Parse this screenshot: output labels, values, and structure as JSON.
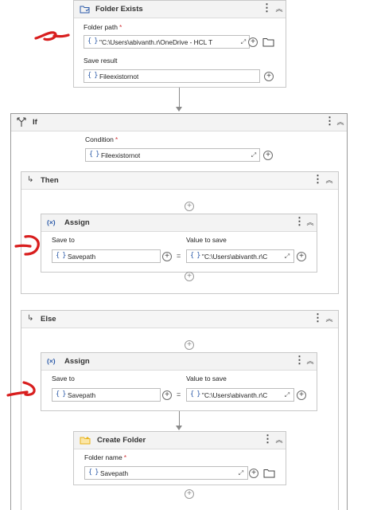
{
  "folder_exists": {
    "title": "Folder Exists",
    "folder_path_label": "Folder path",
    "folder_path_value": "\"C:\\Users\\abivanth.r\\OneDrive - HCL T",
    "save_result_label": "Save result",
    "save_result_value": "Fileexistornot"
  },
  "if_block": {
    "title": "If",
    "condition_label": "Condition",
    "condition_value": "Fileexistornot"
  },
  "then_block": {
    "title": "Then",
    "assign": {
      "title": "Assign",
      "save_to_label": "Save to",
      "save_to_value": "Savepath",
      "value_label": "Value to save",
      "value_value": "\"C:\\Users\\abivanth.r\\C"
    }
  },
  "else_block": {
    "title": "Else",
    "assign": {
      "title": "Assign",
      "save_to_label": "Save to",
      "save_to_value": "Savepath",
      "value_label": "Value to save",
      "value_value": "\"C:\\Users\\abivanth.r\\C"
    },
    "create_folder": {
      "title": "Create Folder",
      "folder_name_label": "Folder name",
      "folder_name_value": "Savepath"
    }
  },
  "symbols": {
    "required": "*",
    "braces": "{ }",
    "assign_icon": "(×)",
    "equals": "=",
    "plus": "+",
    "kebab": "⋮",
    "collapse": "︽",
    "expand": "⤢",
    "branch_arrow": "↳"
  },
  "colors": {
    "annotation": "#d81e1e",
    "accent_blue": "#2b5aa8",
    "folder_yellow": "#e8b31a",
    "header_bg": "#f3f3f3"
  }
}
